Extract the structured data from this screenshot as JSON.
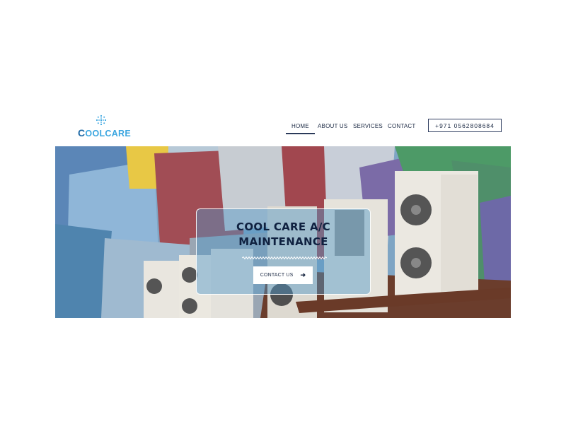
{
  "logo": {
    "text_first": "C",
    "text_rest": "OOLCARE"
  },
  "nav": {
    "items": [
      "HOME",
      "ABOUT US",
      "SERVICES",
      "CONTACT"
    ],
    "active": "HOME"
  },
  "phone": "+971 0562808684",
  "hero": {
    "title_line1": "COOL CARE A/C",
    "title_line2": "MAINTENANCE",
    "button_label": "CONTACT US"
  },
  "colors": {
    "brand": "#3ba6e0",
    "brand_dark": "#1f6aa6",
    "nav_text": "#1c2a44"
  }
}
